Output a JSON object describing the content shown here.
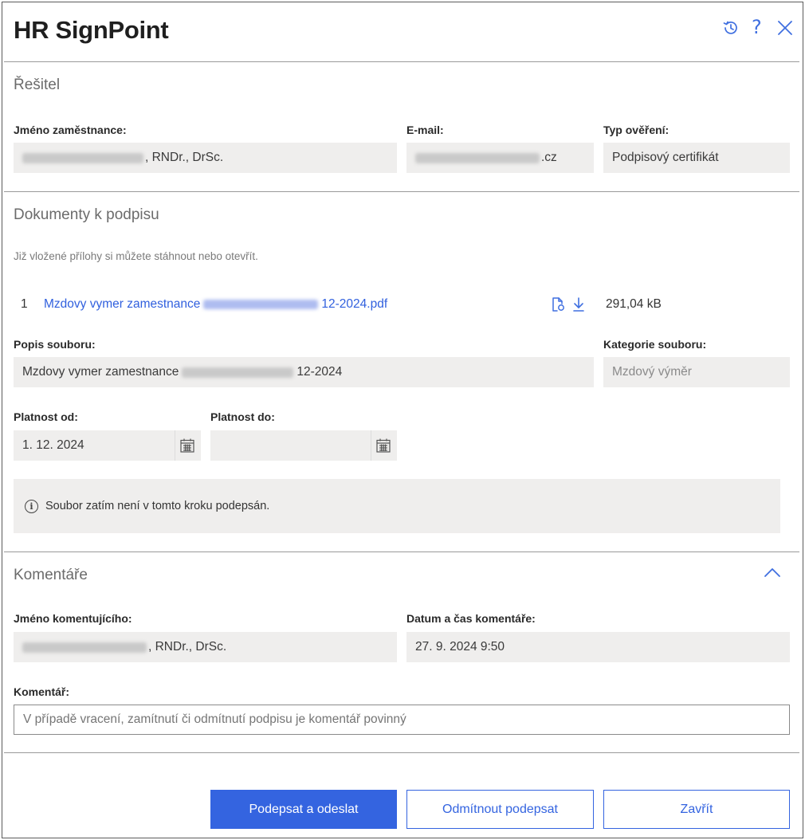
{
  "header": {
    "title": "HR SignPoint",
    "history_icon": "history-icon",
    "help_icon": "help-icon",
    "close_icon": "close-icon",
    "help_glyph": "?"
  },
  "solver": {
    "section_title": "Řešitel",
    "employee_name_label": "Jméno zaměstnance:",
    "employee_name_value_suffix": ", RNDr., DrSc.",
    "email_label": "E-mail:",
    "email_value_suffix": ".cz",
    "verification_label": "Typ ověření:",
    "verification_value": "Podpisový certifikát"
  },
  "documents": {
    "section_title": "Dokumenty k podpisu",
    "hint": "Již vložené přílohy si můžete stáhnout nebo otevřít.",
    "items": [
      {
        "index": "1",
        "name_prefix": "Mzdovy vymer zamestnance",
        "name_suffix": "12-2024.pdf",
        "size": "291,04 kB"
      }
    ],
    "file_description_label": "Popis souboru:",
    "file_description_prefix": "Mzdovy vymer zamestnance",
    "file_description_suffix": "12-2024",
    "file_category_label": "Kategorie souboru:",
    "file_category_value": "Mzdový výměr",
    "valid_from_label": "Platnost od:",
    "valid_from_value": "1. 12. 2024",
    "valid_to_label": "Platnost do:",
    "valid_to_value": "",
    "info_text": "Soubor zatím není v tomto kroku podepsán.",
    "info_glyph": "i"
  },
  "comments": {
    "section_title": "Komentáře",
    "commenter_label": "Jméno komentujícího:",
    "commenter_value_suffix": ", RNDr., DrSc.",
    "datetime_label": "Datum a čas komentáře:",
    "datetime_value": "27. 9. 2024 9:50",
    "comment_label": "Komentář:",
    "comment_placeholder": "V případě vracení, zamítnutí či odmítnutí podpisu je komentář povinný"
  },
  "footer": {
    "sign_send": "Podepsat a odeslat",
    "refuse_sign": "Odmítnout podepsat",
    "close": "Zavřít"
  },
  "colors": {
    "accent": "#3464e0",
    "field_bg": "#efeeed"
  }
}
